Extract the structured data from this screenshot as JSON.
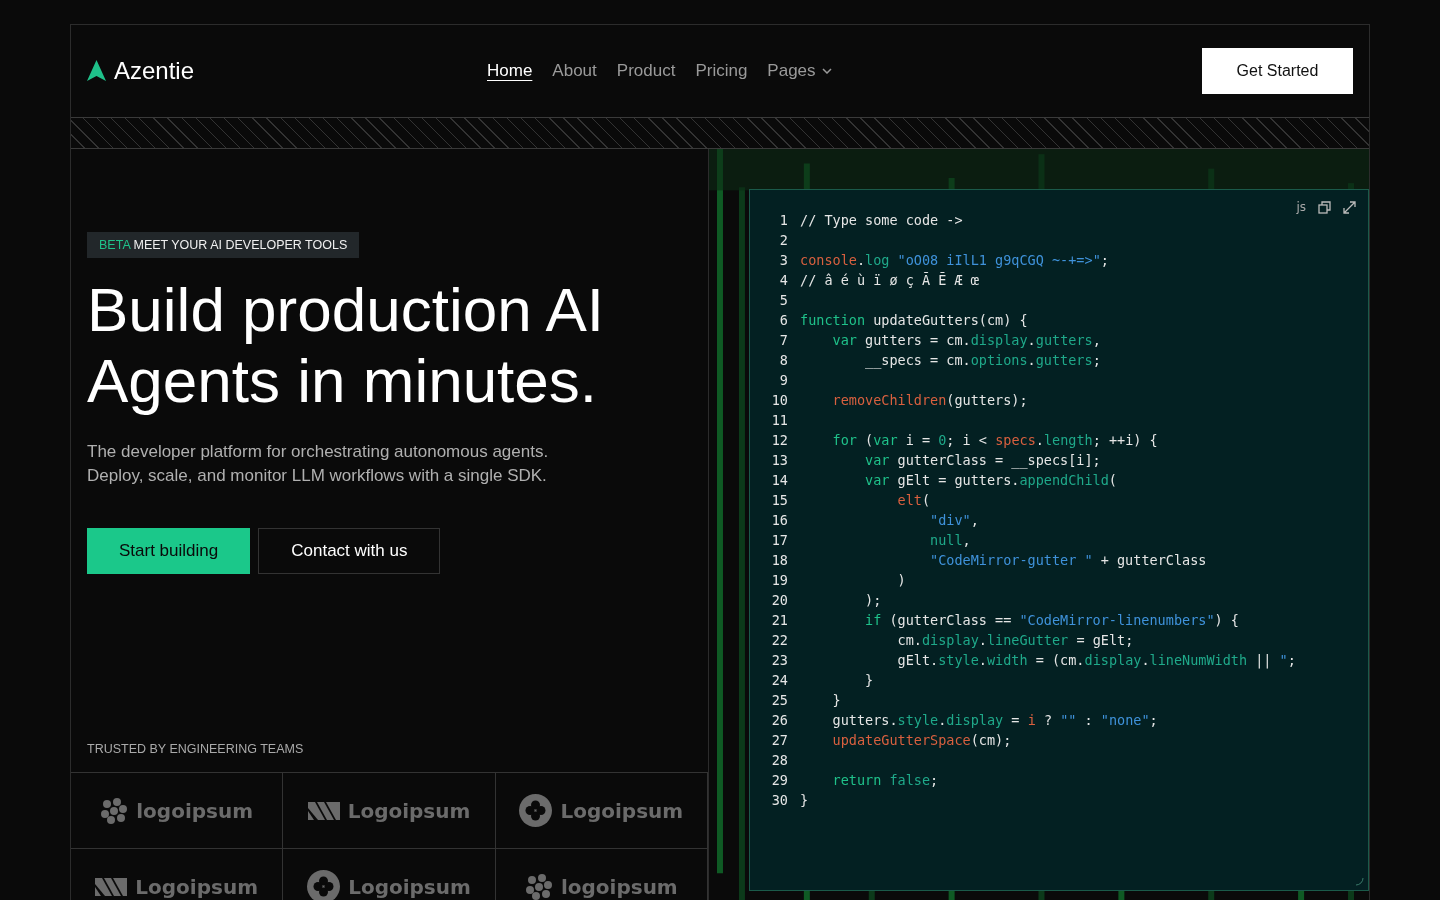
{
  "brand": {
    "name": "Azentie"
  },
  "nav": [
    {
      "label": "Home",
      "selected": true,
      "dropdown": false
    },
    {
      "label": "About",
      "selected": false,
      "dropdown": false
    },
    {
      "label": "Product",
      "selected": false,
      "dropdown": false
    },
    {
      "label": "Pricing",
      "selected": false,
      "dropdown": false
    },
    {
      "label": "Pages",
      "selected": false,
      "dropdown": true
    }
  ],
  "cta": "Get Started",
  "hero": {
    "badge_tag": "BETA",
    "badge_text": "MEET YOUR AI DEVELOPER TOOLS",
    "title_lines": [
      "Build production AI",
      "Agents in minutes."
    ],
    "description_lines": [
      "The developer platform for orchestrating autonomous agents.",
      "Deploy, scale, and monitor LLM workflows with a single SDK."
    ],
    "buttons": [
      {
        "label": "Start building",
        "kind": "primary"
      },
      {
        "label": "Contact with us",
        "kind": "outline"
      }
    ]
  },
  "trusted": {
    "label": "TRUSTED BY ENGINEERING TEAMS",
    "logos": [
      {
        "name": "logoipsum",
        "kind": "dots"
      },
      {
        "name": "Logoipsum",
        "kind": "stripes"
      },
      {
        "name": "Logoipsum",
        "kind": "circle"
      },
      {
        "name": "Logoipsum",
        "kind": "stripes"
      },
      {
        "name": "Logoipsum",
        "kind": "circle"
      },
      {
        "name": "logoipsum",
        "kind": "dots"
      }
    ]
  },
  "editor": {
    "language": "js",
    "lines": [
      {
        "number": "1",
        "tokens": [
          {
            "kind": "comment",
            "text": "// Type some code ->"
          }
        ]
      },
      {
        "number": "2"
      },
      {
        "number": "3",
        "tokens": [
          {
            "kind": "func",
            "text": "console"
          },
          {
            "kind": "plain",
            "text": "."
          },
          {
            "kind": "prop",
            "text": "log"
          },
          {
            "kind": "string",
            "text": " \"oO08 iIlL1 g9qCGQ ~-+=>\""
          },
          {
            "kind": "plain",
            "text": ";"
          }
        ]
      },
      {
        "number": "4",
        "tokens": [
          {
            "kind": "comment",
            "text": "// â é ù ï ø ç Ã Ē Æ œ"
          }
        ]
      },
      {
        "number": "5"
      },
      {
        "number": "6",
        "tokens": [
          {
            "kind": "keyword",
            "text": "function"
          },
          {
            "kind": "plain",
            "text": " updateGutters(cm) {"
          }
        ]
      },
      {
        "number": "7",
        "tokens": [
          {
            "kind": "keyword",
            "text": "    var"
          },
          {
            "kind": "plain",
            "text": " gutters = cm."
          },
          {
            "kind": "prop",
            "text": "display"
          },
          {
            "kind": "plain",
            "text": "."
          },
          {
            "kind": "prop",
            "text": "gutters"
          },
          {
            "kind": "plain",
            "text": ","
          }
        ]
      },
      {
        "number": "8",
        "tokens": [
          {
            "kind": "plain",
            "text": "        __specs = cm."
          },
          {
            "kind": "prop",
            "text": "options"
          },
          {
            "kind": "plain",
            "text": "."
          },
          {
            "kind": "prop",
            "text": "gutters"
          },
          {
            "kind": "plain",
            "text": ";"
          }
        ]
      },
      {
        "number": "9"
      },
      {
        "number": "10",
        "tokens": [
          {
            "kind": "func",
            "text": "    removeChildren"
          },
          {
            "kind": "plain",
            "text": "(gutters);"
          }
        ]
      },
      {
        "number": "11"
      },
      {
        "number": "12",
        "tokens": [
          {
            "kind": "keyword",
            "text": "    for"
          },
          {
            "kind": "plain",
            "text": " ("
          },
          {
            "kind": "keyword",
            "text": "var"
          },
          {
            "kind": "plain",
            "text": " i = "
          },
          {
            "kind": "number",
            "text": "0"
          },
          {
            "kind": "plain",
            "text": "; i < "
          },
          {
            "kind": "func",
            "text": "specs"
          },
          {
            "kind": "plain",
            "text": "."
          },
          {
            "kind": "prop",
            "text": "length"
          },
          {
            "kind": "plain",
            "text": "; ++i) {"
          }
        ]
      },
      {
        "number": "13",
        "tokens": [
          {
            "kind": "keyword",
            "text": "        var"
          },
          {
            "kind": "plain",
            "text": " gutterClass = __specs[i];"
          }
        ]
      },
      {
        "number": "14",
        "tokens": [
          {
            "kind": "keyword",
            "text": "        var"
          },
          {
            "kind": "plain",
            "text": " gElt = gutters."
          },
          {
            "kind": "prop",
            "text": "appendChild"
          },
          {
            "kind": "plain",
            "text": "("
          }
        ]
      },
      {
        "number": "15",
        "tokens": [
          {
            "kind": "func",
            "text": "            elt"
          },
          {
            "kind": "plain",
            "text": "("
          }
        ]
      },
      {
        "number": "16",
        "tokens": [
          {
            "kind": "string",
            "text": "                \"div\""
          },
          {
            "kind": "plain",
            "text": ","
          }
        ]
      },
      {
        "number": "17",
        "tokens": [
          {
            "kind": "number",
            "text": "                null"
          },
          {
            "kind": "plain",
            "text": ","
          }
        ]
      },
      {
        "number": "18",
        "tokens": [
          {
            "kind": "string",
            "text": "                \"CodeMirror-gutter \""
          },
          {
            "kind": "plain",
            "text": " + gutterClass"
          }
        ]
      },
      {
        "number": "19",
        "tokens": [
          {
            "kind": "plain",
            "text": "            )"
          }
        ]
      },
      {
        "number": "20",
        "tokens": [
          {
            "kind": "plain",
            "text": "        );"
          }
        ]
      },
      {
        "number": "21",
        "tokens": [
          {
            "kind": "keyword",
            "text": "        if"
          },
          {
            "kind": "plain",
            "text": " (gutterClass == "
          },
          {
            "kind": "string",
            "text": "\"CodeMirror-linenumbers\""
          },
          {
            "kind": "plain",
            "text": ") {"
          }
        ]
      },
      {
        "number": "22",
        "tokens": [
          {
            "kind": "plain",
            "text": "            cm."
          },
          {
            "kind": "prop",
            "text": "display"
          },
          {
            "kind": "plain",
            "text": "."
          },
          {
            "kind": "prop",
            "text": "lineGutter"
          },
          {
            "kind": "plain",
            "text": " = gElt;"
          }
        ]
      },
      {
        "number": "23",
        "tokens": [
          {
            "kind": "plain",
            "text": "            gElt."
          },
          {
            "kind": "prop",
            "text": "style"
          },
          {
            "kind": "plain",
            "text": "."
          },
          {
            "kind": "prop",
            "text": "width"
          },
          {
            "kind": "plain",
            "text": " = (cm."
          },
          {
            "kind": "prop",
            "text": "display"
          },
          {
            "kind": "plain",
            "text": "."
          },
          {
            "kind": "prop",
            "text": "lineNumWidth"
          },
          {
            "kind": "plain",
            "text": " || "
          },
          {
            "kind": "string",
            "text": "\""
          },
          {
            "kind": "plain",
            "text": ";"
          }
        ]
      },
      {
        "number": "24",
        "tokens": [
          {
            "kind": "plain",
            "text": "        }"
          }
        ]
      },
      {
        "number": "25",
        "tokens": [
          {
            "kind": "plain",
            "text": "    }"
          }
        ]
      },
      {
        "number": "26",
        "tokens": [
          {
            "kind": "plain",
            "text": "    gutters."
          },
          {
            "kind": "prop",
            "text": "style"
          },
          {
            "kind": "plain",
            "text": "."
          },
          {
            "kind": "prop",
            "text": "display"
          },
          {
            "kind": "plain",
            "text": " = "
          },
          {
            "kind": "func",
            "text": "i"
          },
          {
            "kind": "plain",
            "text": " ? "
          },
          {
            "kind": "string",
            "text": "\"\""
          },
          {
            "kind": "plain",
            "text": " : "
          },
          {
            "kind": "string",
            "text": "\"none\""
          },
          {
            "kind": "plain",
            "text": ";"
          }
        ]
      },
      {
        "number": "27",
        "tokens": [
          {
            "kind": "func",
            "text": "    updateGutterSpace"
          },
          {
            "kind": "plain",
            "text": "(cm);"
          }
        ]
      },
      {
        "number": "28"
      },
      {
        "number": "29",
        "tokens": [
          {
            "kind": "keyword",
            "text": "    return"
          },
          {
            "kind": "number",
            "text": " false"
          },
          {
            "kind": "plain",
            "text": ";"
          }
        ]
      },
      {
        "number": "30",
        "tokens": [
          {
            "kind": "plain",
            "text": "}"
          }
        ]
      }
    ]
  }
}
